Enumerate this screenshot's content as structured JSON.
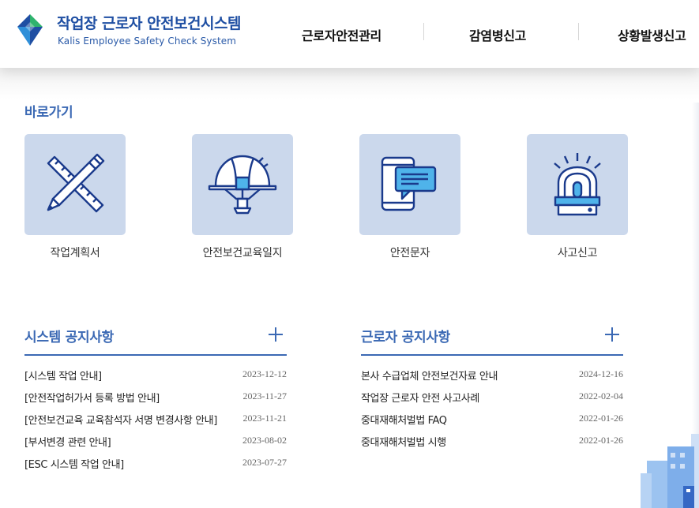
{
  "brand": {
    "title_ko": "작업장 근로자 안전보건시스템",
    "title_en": "Kalis Employee Safety Check System",
    "colors": {
      "primary": "#1f4fa3",
      "accent": "#3b69b4",
      "logo_green": "#2fb36d",
      "card_bg": "#cbd8ec",
      "icon_stroke": "#1a3a8c"
    }
  },
  "nav": {
    "items": [
      {
        "label": "근로자안전관리"
      },
      {
        "label": "감염병신고"
      },
      {
        "label": "상황발생신고"
      }
    ]
  },
  "quick": {
    "title": "바로가기",
    "items": [
      {
        "label": "작업계획서",
        "icon": "pencil-ruler-icon"
      },
      {
        "label": "안전보건교육일지",
        "icon": "safety-helmet-icon"
      },
      {
        "label": "안전문자",
        "icon": "smartphone-message-icon"
      },
      {
        "label": "사고신고",
        "icon": "siren-icon"
      }
    ]
  },
  "system_notices": {
    "title": "시스템 공지사항",
    "more_icon": "plus-icon",
    "items": [
      {
        "title": "[시스템 작업 안내]",
        "date": "2023-12-12"
      },
      {
        "title": "[안전작업허가서 등록 방법 안내]",
        "date": "2023-11-27"
      },
      {
        "title": "[안전보건교육 교육참석자 서명 변경사항 안내]",
        "date": "2023-11-21"
      },
      {
        "title": "[부서변경 관련 안내]",
        "date": "2023-08-02"
      },
      {
        "title": "[ESC 시스템 작업 안내]",
        "date": "2023-07-27"
      }
    ]
  },
  "worker_notices": {
    "title": "근로자 공지사항",
    "more_icon": "plus-icon",
    "items": [
      {
        "title": "본사 수급업체 안전보건자료 안내",
        "date": "2024-12-16"
      },
      {
        "title": "작업장 근로자 안전 사고사례",
        "date": "2022-02-04"
      },
      {
        "title": "중대재해처벌법 FAQ",
        "date": "2022-01-26"
      },
      {
        "title": "중대재해처벌법 시행",
        "date": "2022-01-26"
      }
    ]
  }
}
